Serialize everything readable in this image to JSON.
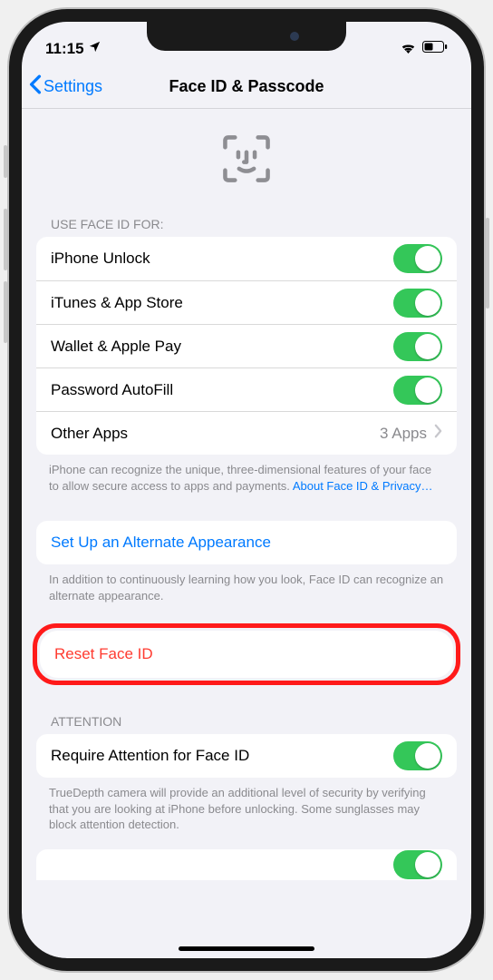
{
  "status": {
    "time": "11:15",
    "location_icon": "location-arrow",
    "wifi_icon": "wifi",
    "battery_icon": "battery-half"
  },
  "nav": {
    "back_label": "Settings",
    "title": "Face ID & Passcode"
  },
  "use_faceid": {
    "header": "USE FACE ID FOR:",
    "items": [
      {
        "label": "iPhone Unlock",
        "toggle": true
      },
      {
        "label": "iTunes & App Store",
        "toggle": true
      },
      {
        "label": "Wallet & Apple Pay",
        "toggle": true
      },
      {
        "label": "Password AutoFill",
        "toggle": true
      }
    ],
    "other_apps_label": "Other Apps",
    "other_apps_value": "3 Apps",
    "footer_text": "iPhone can recognize the unique, three-dimensional features of your face to allow secure access to apps and payments. ",
    "footer_link": "About Face ID & Privacy…"
  },
  "alternate": {
    "label": "Set Up an Alternate Appearance",
    "footer": "In addition to continuously learning how you look, Face ID can recognize an alternate appearance."
  },
  "reset": {
    "label": "Reset Face ID"
  },
  "attention": {
    "header": "ATTENTION",
    "item_label": "Require Attention for Face ID",
    "item_toggle": true,
    "footer": "TrueDepth camera will provide an additional level of security by verifying that you are looking at iPhone before unlocking. Some sunglasses may block attention detection."
  }
}
